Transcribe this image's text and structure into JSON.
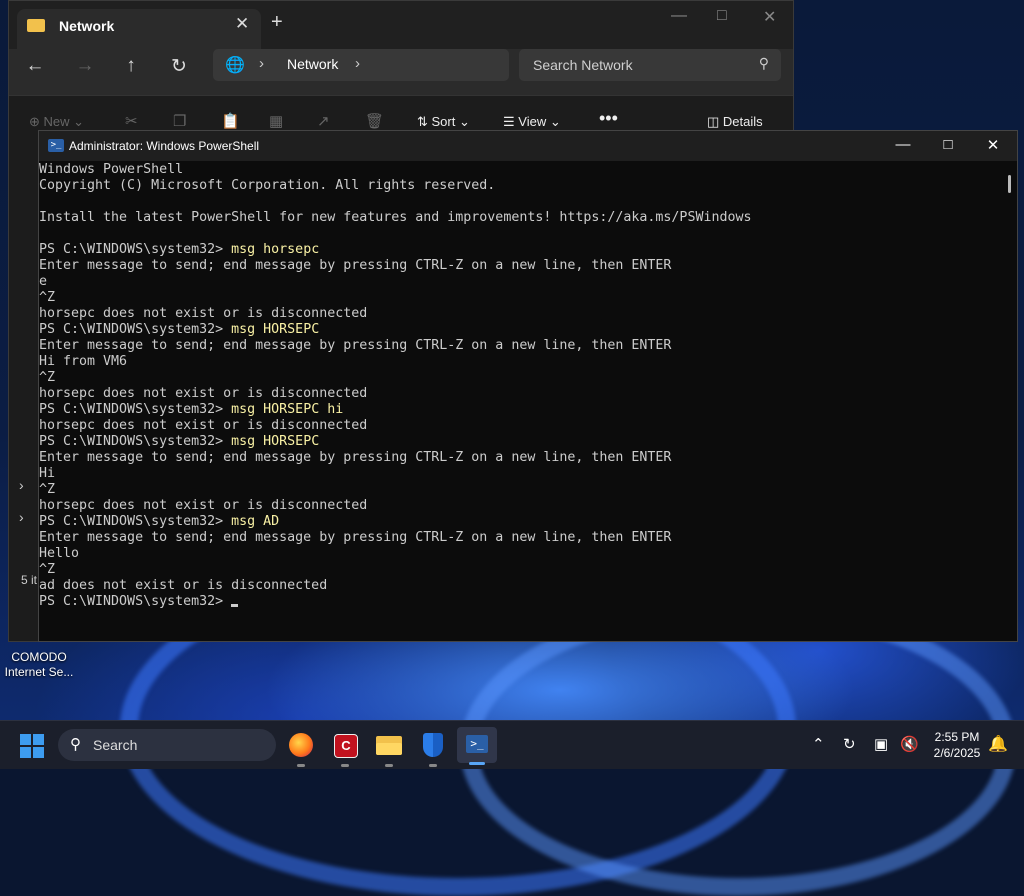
{
  "desktop": {
    "icon_label_line1": "COMODO",
    "icon_label_line2": "Internet Se..."
  },
  "explorer": {
    "tab_title": "Network",
    "breadcrumb": "Network",
    "search_placeholder": "Search Network",
    "commands": {
      "new": "New",
      "sort": "Sort",
      "view": "View",
      "details": "Details"
    },
    "status": "5 it"
  },
  "powershell": {
    "title": "Administrator: Windows PowerShell",
    "lines": [
      {
        "text": "Windows PowerShell"
      },
      {
        "text": "Copyright (C) Microsoft Corporation. All rights reserved."
      },
      {
        "text": ""
      },
      {
        "text": "Install the latest PowerShell for new features and improvements! https://aka.ms/PSWindows"
      },
      {
        "text": ""
      },
      {
        "prompt": "PS C:\\WINDOWS\\system32> ",
        "cmd": "msg horsepc"
      },
      {
        "text": "Enter message to send; end message by pressing CTRL-Z on a new line, then ENTER"
      },
      {
        "text": "e"
      },
      {
        "text": "^Z"
      },
      {
        "text": "horsepc does not exist or is disconnected"
      },
      {
        "prompt": "PS C:\\WINDOWS\\system32> ",
        "cmd": "msg HORSEPC"
      },
      {
        "text": "Enter message to send; end message by pressing CTRL-Z on a new line, then ENTER"
      },
      {
        "text": "Hi from VM6"
      },
      {
        "text": "^Z"
      },
      {
        "text": "horsepc does not exist or is disconnected"
      },
      {
        "prompt": "PS C:\\WINDOWS\\system32> ",
        "cmd": "msg HORSEPC hi"
      },
      {
        "text": "horsepc does not exist or is disconnected"
      },
      {
        "prompt": "PS C:\\WINDOWS\\system32> ",
        "cmd": "msg HORSEPC"
      },
      {
        "text": "Enter message to send; end message by pressing CTRL-Z on a new line, then ENTER"
      },
      {
        "text": "Hi"
      },
      {
        "text": "^Z"
      },
      {
        "text": "horsepc does not exist or is disconnected"
      },
      {
        "prompt": "PS C:\\WINDOWS\\system32> ",
        "cmd": "msg AD"
      },
      {
        "text": "Enter message to send; end message by pressing CTRL-Z on a new line, then ENTER"
      },
      {
        "text": "Hello"
      },
      {
        "text": "^Z"
      },
      {
        "text": "ad does not exist or is disconnected"
      },
      {
        "prompt": "PS C:\\WINDOWS\\system32> ",
        "cmd": "",
        "cursor": true
      }
    ]
  },
  "taskbar": {
    "search_label": "Search",
    "time": "2:55 PM",
    "date": "2/6/2025",
    "apps": [
      "firefox-icon",
      "comodo-icon",
      "file-explorer-icon",
      "windows-security-icon",
      "powershell-icon"
    ]
  },
  "colors": {
    "terminal_bg": "#0c0c0c",
    "terminal_text": "#cccccc",
    "command_text": "#f9f1a5",
    "accent": "#3d9cf0"
  }
}
